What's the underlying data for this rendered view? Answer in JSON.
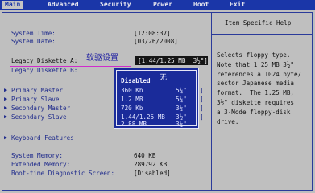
{
  "menu": {
    "tabs": [
      "Main",
      "Advanced",
      "Security",
      "Power",
      "Boot",
      "Exit"
    ]
  },
  "help": {
    "title": "Item Specific Help",
    "text": "Selects floppy type.\nNote that 1.25 MB 3½\"\nreferences a 1024 byte/\nsector Japanese media\nformat.  The 1.25 MB,\n3½\" diskette requires\na 3-Mode floppy-disk\ndrive."
  },
  "main": {
    "system_time_label": "System Time:",
    "system_time_value": "[12:08:37]",
    "system_date_label": "System Date:",
    "system_date_value": "[03/26/2008]",
    "legacy_a_label": "Legacy Diskette A:",
    "legacy_a_value": "[1.44/1.25 MB  3½\"]",
    "legacy_b_label": "Legacy Diskette B:",
    "annotation": "软驱设置",
    "submenus": [
      "Primary Master",
      "Primary Slave",
      "Secondary Master",
      "Secondary Slave"
    ],
    "keyboard_features": "Keyboard Features",
    "system_memory_label": "System Memory:",
    "system_memory_value": "640 KB",
    "extended_memory_label": "Extended Memory:",
    "extended_memory_value": "289792 KB",
    "boot_diag_label": "Boot-time Diagnostic Screen:",
    "boot_diag_value": "[Disabled]"
  },
  "popup": {
    "selected": "Disabled",
    "selected_annotation": "无",
    "options": [
      {
        "size": "360 Kb",
        "form": "5¼\""
      },
      {
        "size": "1.2 MB",
        "form": "5¼\""
      },
      {
        "size": "720 Kb",
        "form": "3½\""
      },
      {
        "size": "1.44/1.25 MB",
        "form": "3½\""
      },
      {
        "size": "2.88 MB",
        "form": "3½\""
      }
    ]
  },
  "colors": {
    "menubar": "#1a36a8",
    "background": "#bfbfbf",
    "label": "#1f2b8c",
    "popup": "#1a2b9a",
    "annotation_underline": "#d02ccc"
  }
}
